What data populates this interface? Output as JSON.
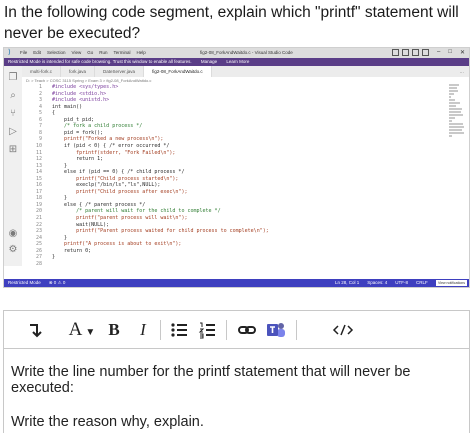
{
  "question": "In the following code segment, explain which \"printf\" statement will never be executed?",
  "vscode": {
    "menu": [
      "File",
      "Edit",
      "Selection",
      "View",
      "Go",
      "Run",
      "Terminal",
      "Help"
    ],
    "window_title": "fig2-08_ForkAndWaitdo.c - Visual Studio Code",
    "restricted_banner": "Restricted Mode is intended for safe code browsing. Trust this window to enable all features.",
    "banner_links": [
      "Manage",
      "Learn More"
    ],
    "tabs": [
      {
        "label": "multi-fork.c",
        "active": false
      },
      {
        "label": "fork.java",
        "active": false
      },
      {
        "label": "DateServer.java",
        "active": false
      },
      {
        "label": "fig2-08_ForkAndWaitdo.c",
        "active": true
      }
    ],
    "breadcrumb": "D: > Teach > COSC 3115 Spring > Exam 3 > fig2-08_ForkAndWaitdo.c",
    "code_lines": [
      {
        "n": "1",
        "t": "#include <sys/types.h>",
        "k": "dir"
      },
      {
        "n": "2",
        "t": "#include <stdio.h>",
        "k": "dir"
      },
      {
        "n": "3",
        "t": "#include <unistd.h>",
        "k": "dir"
      },
      {
        "n": "4",
        "t": "int main()",
        "k": ""
      },
      {
        "n": "5",
        "t": "{",
        "k": ""
      },
      {
        "n": "6",
        "t": "    pid_t pid;",
        "k": ""
      },
      {
        "n": "7",
        "t": "    /* fork a child process */",
        "k": "com"
      },
      {
        "n": "8",
        "t": "    pid = fork();",
        "k": ""
      },
      {
        "n": "9",
        "t": "    printf(\"Forked a new process\\n\");",
        "k": "str"
      },
      {
        "n": "10",
        "t": "    if (pid < 0) { /* error occurred */",
        "k": ""
      },
      {
        "n": "11",
        "t": "        fprintf(stderr, \"Fork Failed\\n\");",
        "k": "str"
      },
      {
        "n": "12",
        "t": "        return 1;",
        "k": ""
      },
      {
        "n": "13",
        "t": "    }",
        "k": ""
      },
      {
        "n": "14",
        "t": "    else if (pid == 0) { /* child process */",
        "k": ""
      },
      {
        "n": "15",
        "t": "        printf(\"Child process started\\n\");",
        "k": "str"
      },
      {
        "n": "16",
        "t": "        execlp(\"/bin/ls\",\"ls\",NULL);",
        "k": ""
      },
      {
        "n": "17",
        "t": "        printf(\"Child process after exec\\n\");",
        "k": "str"
      },
      {
        "n": "18",
        "t": "    }",
        "k": ""
      },
      {
        "n": "19",
        "t": "    else { /* parent process */",
        "k": ""
      },
      {
        "n": "20",
        "t": "        /* parent will wait for the child to complete */",
        "k": "com"
      },
      {
        "n": "21",
        "t": "        printf(\"parent process will wait\\n\");",
        "k": "str"
      },
      {
        "n": "22",
        "t": "        wait(NULL);",
        "k": ""
      },
      {
        "n": "23",
        "t": "        printf(\"Parent process waited for child process to complete\\n\");",
        "k": "str"
      },
      {
        "n": "24",
        "t": "    }",
        "k": ""
      },
      {
        "n": "25",
        "t": "    printf(\"A process is about to exit\\n\");",
        "k": "str"
      },
      {
        "n": "26",
        "t": "    return 0;",
        "k": ""
      },
      {
        "n": "27",
        "t": "}",
        "k": ""
      },
      {
        "n": "28",
        "t": "",
        "k": ""
      }
    ],
    "status_left": [
      "Restricted Mode",
      "⊗ 0 ⚠ 0"
    ],
    "status_right": [
      "Ln 28, Col 1",
      "Spaces: 4",
      "UTF-8",
      "CRLF",
      "C"
    ],
    "notification": "View notifications"
  },
  "toolbar": {
    "icons": [
      "insert-arrow-icon",
      "font-color-icon",
      "bold-icon",
      "italic-icon",
      "bullet-list-icon",
      "numbered-list-icon",
      "link-icon",
      "teams-icon",
      "code-icon"
    ],
    "font_letter": "A",
    "bold_letter": "B",
    "italic_letter": "I"
  },
  "prompts": {
    "line_number": "Write the line number for the printf statement that will never be executed:",
    "reason": "Write the reason why, explain."
  },
  "colors": {
    "restricted_banner": "#5a3d87",
    "status_bar": "#3e3fbf",
    "toolbar_border": "#c8c8c8"
  }
}
